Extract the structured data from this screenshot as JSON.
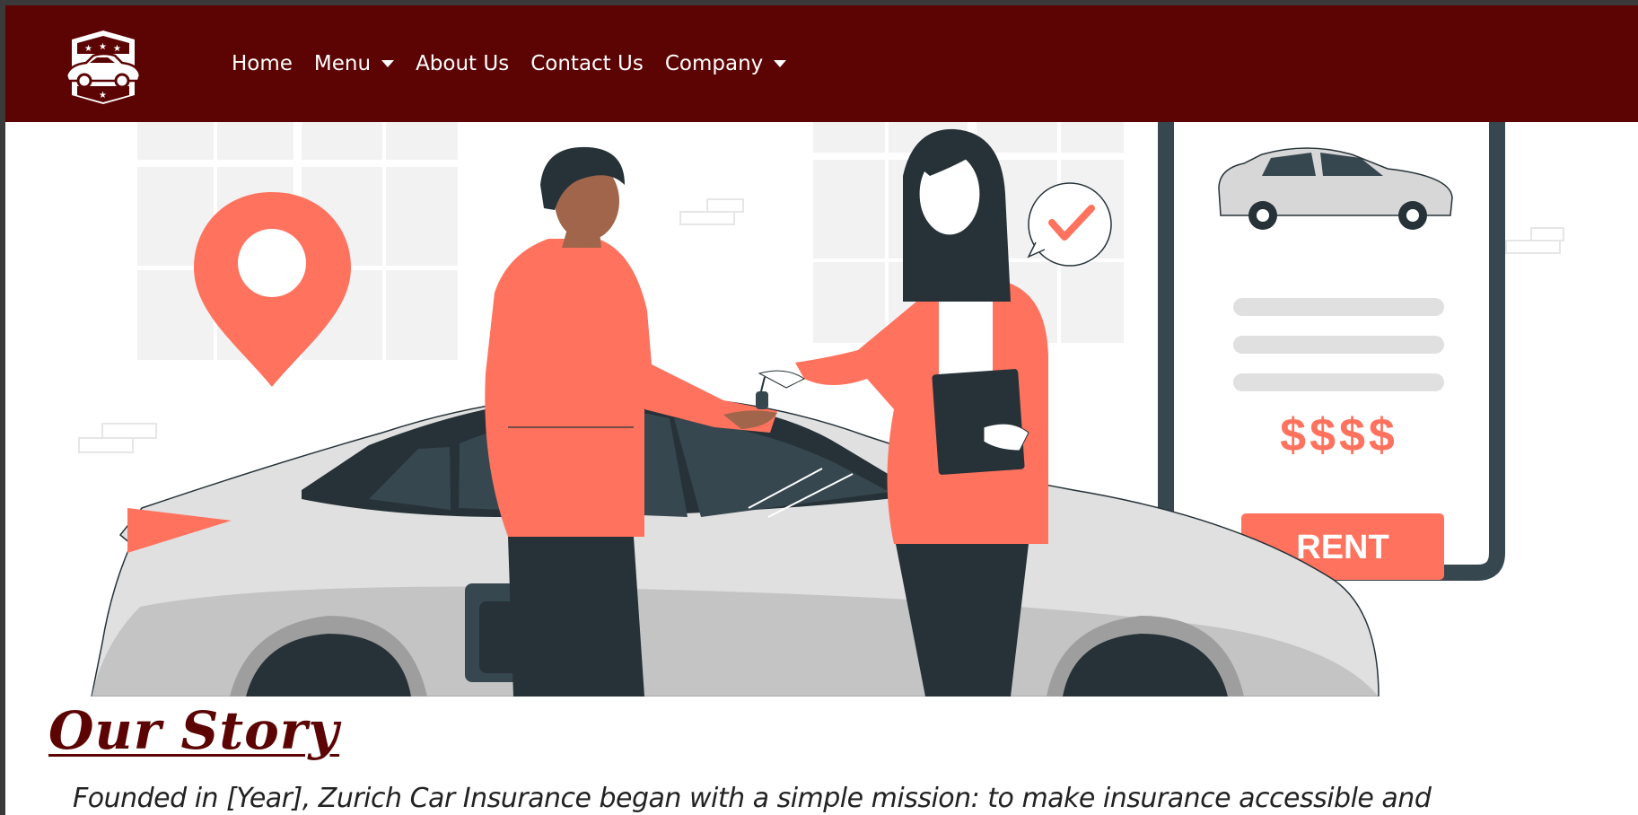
{
  "navbar": {
    "background_color": "#5c0303",
    "logo_icon": "car-badge-logo-icon",
    "items": [
      {
        "label": "Home",
        "dropdown": false
      },
      {
        "label": "Menu",
        "dropdown": true
      },
      {
        "label": "About Us",
        "dropdown": false
      },
      {
        "label": "Contact Us",
        "dropdown": false
      },
      {
        "label": "Company",
        "dropdown": true
      }
    ]
  },
  "hero": {
    "illustration": "car-rental-handover-illustration",
    "price_text": "$$$$",
    "rent_button_label": "RENT",
    "accent_color": "#ff725e"
  },
  "story": {
    "title": "Our Story",
    "text": "Founded in [Year], Zurich Car Insurance began with a simple mission: to make insurance accessible and"
  }
}
